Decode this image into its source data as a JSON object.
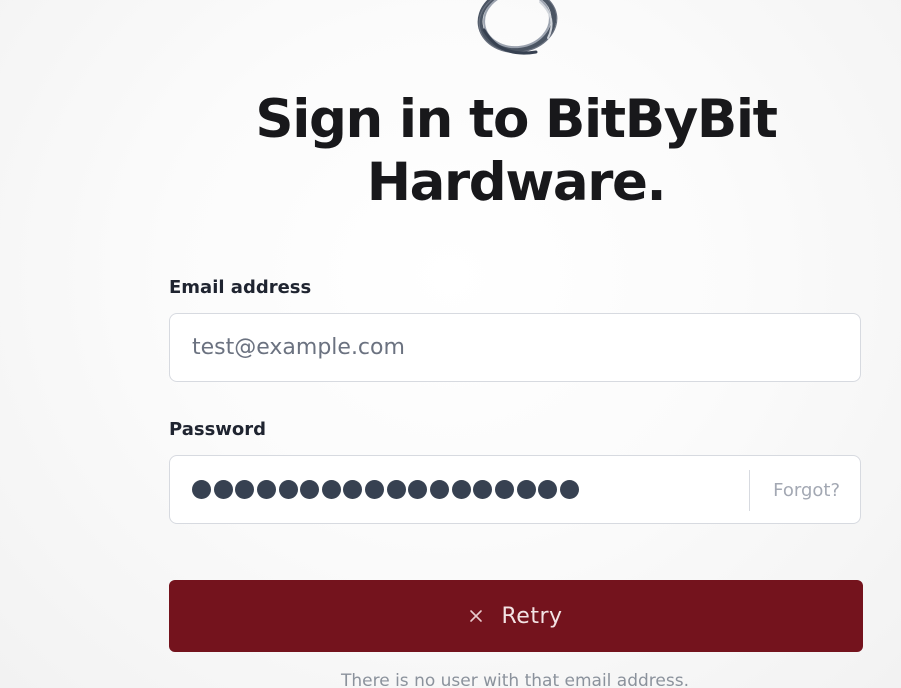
{
  "brand": {
    "logo_icon": "ring-logo-icon"
  },
  "heading": {
    "title": "Sign in to BitByBit Hardware."
  },
  "form": {
    "email": {
      "label": "Email address",
      "value": "test@example.com"
    },
    "password": {
      "label": "Password",
      "masked_length": 18,
      "forgot_label": "Forgot?"
    },
    "retry_button": {
      "label": "Retry",
      "icon": "close-icon",
      "color": "#74131d"
    },
    "error_message": "There is no user with that email address."
  }
}
